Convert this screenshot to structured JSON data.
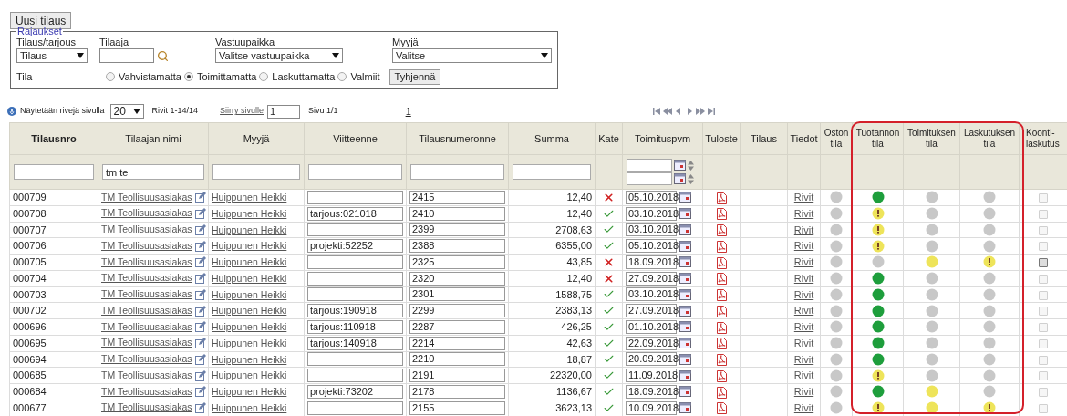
{
  "new_button": "Uusi tilaus",
  "filters": {
    "legend": "Rajaukset",
    "fields": [
      {
        "label": "Tilaus/tarjous",
        "kind": "select",
        "value": "Tilaus"
      },
      {
        "label": "Tilaaja",
        "kind": "search"
      },
      {
        "label": "Vastuupaikka",
        "kind": "select",
        "value": "Valitse vastuupaikka"
      },
      {
        "label": "Myyjä",
        "kind": "select",
        "value": "Valitse"
      }
    ],
    "state_label": "Tila",
    "state_options": [
      {
        "label": "Vahvistamatta",
        "selected": false
      },
      {
        "label": "Toimittamatta",
        "selected": true
      },
      {
        "label": "Laskuttamatta",
        "selected": false
      },
      {
        "label": "Valmiit",
        "selected": false
      }
    ],
    "clear_button": "Tyhjennä"
  },
  "toolbar": {
    "rows_label": "Näytetään rivejä sivulla",
    "page_size": "20",
    "range": "Rivit 1-14/14",
    "goto_link": "Siirry sivulle",
    "goto_value": "1",
    "page_info": "Sivu 1/1",
    "page_link": "1"
  },
  "table": {
    "columns": [
      "Tilausnro",
      "Tilaajan nimi",
      "Myyjä",
      "Viitteenne",
      "Tilausnumeronne",
      "Summa",
      "Kate",
      "Toimituspvm",
      "Tuloste",
      "Tilaus",
      "Tiedot",
      "Oston tila",
      "Tuotannon tila",
      "Toimituksen tila",
      "Laskutuksen tila",
      "Koonti-laskutus"
    ],
    "customer_filter": "tm te",
    "rows": [
      {
        "number": "000709",
        "customer": "TM Teollisuusasiakas",
        "seller": "Huippunen Heikki",
        "order_no": "2415",
        "sum": "12,40",
        "margin_ok": false,
        "date": "05.10.2018",
        "details": "Rivit",
        "purchase": {
          "color": "#c8c8c8",
          "warning": false
        },
        "production": {
          "color": "#1e9e3c",
          "warning": false
        },
        "delivery": {
          "color": "#c8c8c8",
          "warning": false
        },
        "invoicing": {
          "color": "#c8c8c8",
          "warning": false
        },
        "disabled": true
      },
      {
        "number": "000708",
        "customer": "TM Teollisuusasiakas",
        "seller": "Huippunen Heikki",
        "reference": "tarjous:021018",
        "order_no": "2410",
        "sum": "12,40",
        "margin_ok": true,
        "date": "03.10.2018",
        "details": "Rivit",
        "purchase": {
          "color": "#c8c8c8",
          "warning": false
        },
        "production": {
          "color": "#eee45a",
          "warning": true
        },
        "delivery": {
          "color": "#c8c8c8",
          "warning": false
        },
        "invoicing": {
          "color": "#c8c8c8",
          "warning": false
        },
        "disabled": true
      },
      {
        "number": "000707",
        "customer": "TM Teollisuusasiakas",
        "seller": "Huippunen Heikki",
        "order_no": "2399",
        "sum": "2708,63",
        "margin_ok": true,
        "date": "03.10.2018",
        "details": "Rivit",
        "purchase": {
          "color": "#c8c8c8",
          "warning": false
        },
        "production": {
          "color": "#eee45a",
          "warning": true
        },
        "delivery": {
          "color": "#c8c8c8",
          "warning": false
        },
        "invoicing": {
          "color": "#c8c8c8",
          "warning": false
        },
        "disabled": true
      },
      {
        "number": "000706",
        "customer": "TM Teollisuusasiakas",
        "seller": "Huippunen Heikki",
        "reference": "projekti:52252",
        "order_no": "2388",
        "sum": "6355,00",
        "margin_ok": true,
        "date": "05.10.2018",
        "details": "Rivit",
        "purchase": {
          "color": "#c8c8c8",
          "warning": false
        },
        "production": {
          "color": "#eee45a",
          "warning": true
        },
        "delivery": {
          "color": "#c8c8c8",
          "warning": false
        },
        "invoicing": {
          "color": "#c8c8c8",
          "warning": false
        },
        "disabled": true
      },
      {
        "number": "000705",
        "customer": "TM Teollisuusasiakas",
        "seller": "Huippunen Heikki",
        "order_no": "2325",
        "sum": "43,85",
        "margin_ok": false,
        "date": "18.09.2018",
        "details": "Rivit",
        "purchase": {
          "color": "#c8c8c8",
          "warning": false
        },
        "production": {
          "color": "#c8c8c8",
          "warning": false
        },
        "delivery": {
          "color": "#eee45a",
          "warning": false
        },
        "invoicing": {
          "color": "#eee45a",
          "warning": true
        },
        "disabled": false
      },
      {
        "number": "000704",
        "customer": "TM Teollisuusasiakas",
        "seller": "Huippunen Heikki",
        "order_no": "2320",
        "sum": "12,40",
        "margin_ok": false,
        "date": "27.09.2018",
        "details": "Rivit",
        "purchase": {
          "color": "#c8c8c8",
          "warning": false
        },
        "production": {
          "color": "#1e9e3c",
          "warning": false
        },
        "delivery": {
          "color": "#c8c8c8",
          "warning": false
        },
        "invoicing": {
          "color": "#c8c8c8",
          "warning": false
        },
        "disabled": true
      },
      {
        "number": "000703",
        "customer": "TM Teollisuusasiakas",
        "seller": "Huippunen Heikki",
        "order_no": "2301",
        "sum": "1588,75",
        "margin_ok": true,
        "date": "03.10.2018",
        "details": "Rivit",
        "purchase": {
          "color": "#c8c8c8",
          "warning": false
        },
        "production": {
          "color": "#1e9e3c",
          "warning": false
        },
        "delivery": {
          "color": "#c8c8c8",
          "warning": false
        },
        "invoicing": {
          "color": "#c8c8c8",
          "warning": false
        },
        "disabled": true
      },
      {
        "number": "000702",
        "customer": "TM Teollisuusasiakas",
        "seller": "Huippunen Heikki",
        "reference": "tarjous:190918",
        "order_no": "2299",
        "sum": "2383,13",
        "margin_ok": true,
        "date": "27.09.2018",
        "details": "Rivit",
        "purchase": {
          "color": "#c8c8c8",
          "warning": false
        },
        "production": {
          "color": "#1e9e3c",
          "warning": false
        },
        "delivery": {
          "color": "#c8c8c8",
          "warning": false
        },
        "invoicing": {
          "color": "#c8c8c8",
          "warning": false
        },
        "disabled": true
      },
      {
        "number": "000696",
        "customer": "TM Teollisuusasiakas",
        "seller": "Huippunen Heikki",
        "reference": "tarjous:110918",
        "order_no": "2287",
        "sum": "426,25",
        "margin_ok": true,
        "date": "01.10.2018",
        "details": "Rivit",
        "purchase": {
          "color": "#c8c8c8",
          "warning": false
        },
        "production": {
          "color": "#1e9e3c",
          "warning": false
        },
        "delivery": {
          "color": "#c8c8c8",
          "warning": false
        },
        "invoicing": {
          "color": "#c8c8c8",
          "warning": false
        },
        "disabled": true
      },
      {
        "number": "000695",
        "customer": "TM Teollisuusasiakas",
        "seller": "Huippunen Heikki",
        "reference": "tarjous:140918",
        "order_no": "2214",
        "sum": "42,63",
        "margin_ok": true,
        "date": "22.09.2018",
        "details": "Rivit",
        "purchase": {
          "color": "#c8c8c8",
          "warning": false
        },
        "production": {
          "color": "#1e9e3c",
          "warning": false
        },
        "delivery": {
          "color": "#c8c8c8",
          "warning": false
        },
        "invoicing": {
          "color": "#c8c8c8",
          "warning": false
        },
        "disabled": true
      },
      {
        "number": "000694",
        "customer": "TM Teollisuusasiakas",
        "seller": "Huippunen Heikki",
        "order_no": "2210",
        "sum": "18,87",
        "margin_ok": true,
        "date": "20.09.2018",
        "details": "Rivit",
        "purchase": {
          "color": "#c8c8c8",
          "warning": false
        },
        "production": {
          "color": "#1e9e3c",
          "warning": false
        },
        "delivery": {
          "color": "#c8c8c8",
          "warning": false
        },
        "invoicing": {
          "color": "#c8c8c8",
          "warning": false
        },
        "disabled": true
      },
      {
        "number": "000685",
        "customer": "TM Teollisuusasiakas",
        "seller": "Huippunen Heikki",
        "order_no": "2191",
        "sum": "22320,00",
        "margin_ok": true,
        "date": "11.09.2018",
        "details": "Rivit",
        "purchase": {
          "color": "#c8c8c8",
          "warning": false
        },
        "production": {
          "color": "#eee45a",
          "warning": true
        },
        "delivery": {
          "color": "#c8c8c8",
          "warning": false
        },
        "invoicing": {
          "color": "#c8c8c8",
          "warning": false
        },
        "disabled": true
      },
      {
        "number": "000684",
        "customer": "TM Teollisuusasiakas",
        "seller": "Huippunen Heikki",
        "reference": "projekti:73202",
        "order_no": "2178",
        "sum": "1136,67",
        "margin_ok": true,
        "date": "18.09.2018",
        "details": "Rivit",
        "purchase": {
          "color": "#c8c8c8",
          "warning": false
        },
        "production": {
          "color": "#1e9e3c",
          "warning": false
        },
        "delivery": {
          "color": "#eee45a",
          "warning": false
        },
        "invoicing": {
          "color": "#c8c8c8",
          "warning": false
        },
        "disabled": true
      },
      {
        "number": "000677",
        "customer": "TM Teollisuusasiakas",
        "seller": "Huippunen Heikki",
        "order_no": "2155",
        "sum": "3623,13",
        "margin_ok": true,
        "date": "10.09.2018",
        "details": "Rivit",
        "purchase": {
          "color": "#c8c8c8",
          "warning": false
        },
        "production": {
          "color": "#eee45a",
          "warning": true
        },
        "delivery": {
          "color": "#eee45a",
          "warning": false
        },
        "invoicing": {
          "color": "#eee45a",
          "warning": true
        },
        "disabled": true
      }
    ]
  }
}
